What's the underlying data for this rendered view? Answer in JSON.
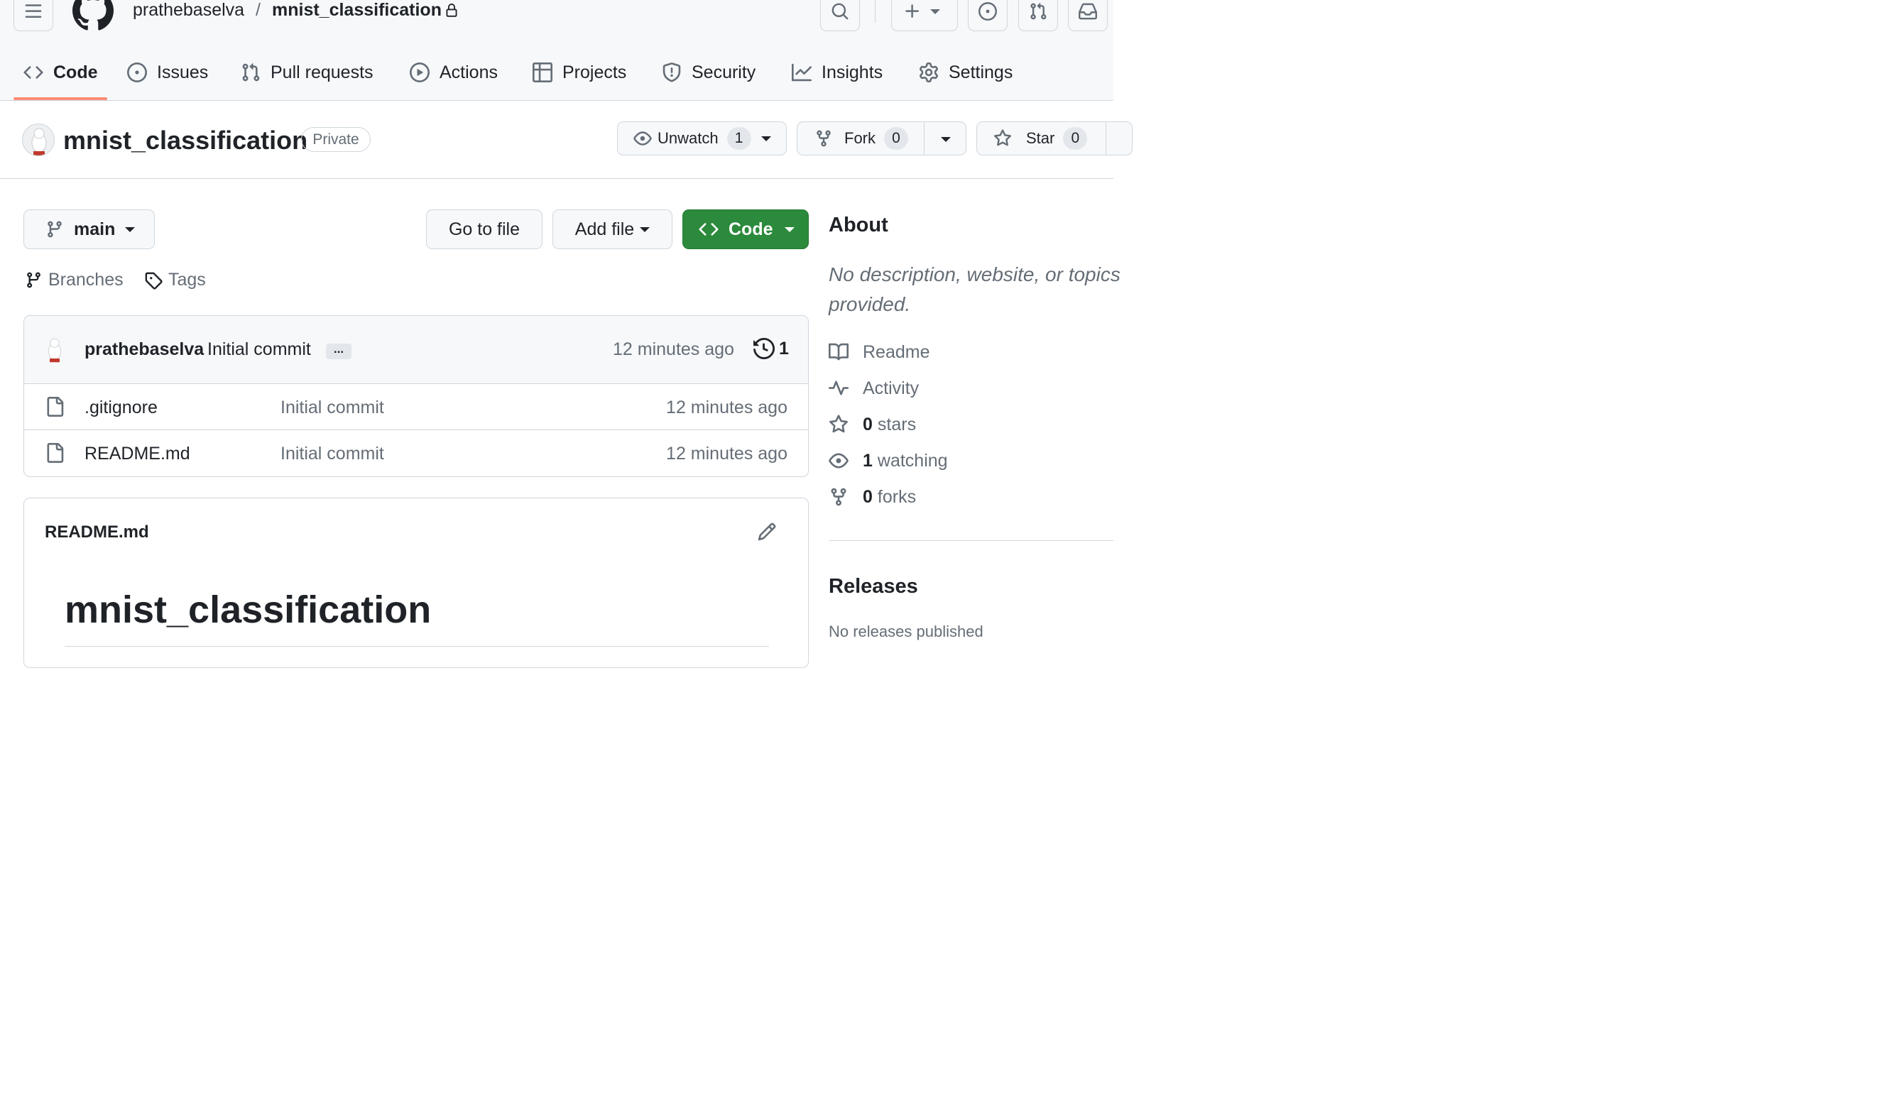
{
  "header": {
    "owner": "prathebaselva",
    "separator": "/",
    "repo": "mnist_classification"
  },
  "tabs": [
    {
      "label": "Code",
      "icon": "code-icon",
      "active": true
    },
    {
      "label": "Issues",
      "icon": "issue-opened-icon"
    },
    {
      "label": "Pull requests",
      "icon": "git-pull-request-icon"
    },
    {
      "label": "Actions",
      "icon": "play-icon"
    },
    {
      "label": "Projects",
      "icon": "table-icon"
    },
    {
      "label": "Security",
      "icon": "shield-icon"
    },
    {
      "label": "Insights",
      "icon": "graph-icon"
    },
    {
      "label": "Settings",
      "icon": "gear-icon"
    }
  ],
  "repo": {
    "name": "mnist_classification",
    "visibility": "Private",
    "unwatch_label": "Unwatch",
    "watch_count": "1",
    "fork_label": "Fork",
    "fork_count": "0",
    "star_label": "Star",
    "star_count": "0"
  },
  "toolbar": {
    "branch": "main",
    "go_to_file": "Go to file",
    "add_file": "Add file",
    "code": "Code",
    "branches": "Branches",
    "tags": "Tags"
  },
  "latest_commit": {
    "author": "prathebaselva",
    "message": "Initial commit",
    "ellipsis": "...",
    "time": "12 minutes ago",
    "commit_count": "1"
  },
  "files": [
    {
      "name": ".gitignore",
      "message": "Initial commit",
      "time": "12 minutes ago"
    },
    {
      "name": "README.md",
      "message": "Initial commit",
      "time": "12 minutes ago"
    }
  ],
  "readme": {
    "filename": "README.md",
    "heading": "mnist_classification"
  },
  "about": {
    "title": "About",
    "description_line1": "No description, website, or topics",
    "description_line2": "provided.",
    "readme": "Readme",
    "activity": "Activity",
    "stars_count": "0",
    "stars_label": "stars",
    "watching_count": "1",
    "watching_label": "watching",
    "forks_count": "0",
    "forks_label": "forks"
  },
  "releases": {
    "title": "Releases",
    "empty": "No releases published"
  },
  "colors": {
    "accent_underline": "#fd8c73",
    "code_button_green": "#2c8a3c",
    "muted_text": "#656d76",
    "border": "#d0d7de"
  }
}
